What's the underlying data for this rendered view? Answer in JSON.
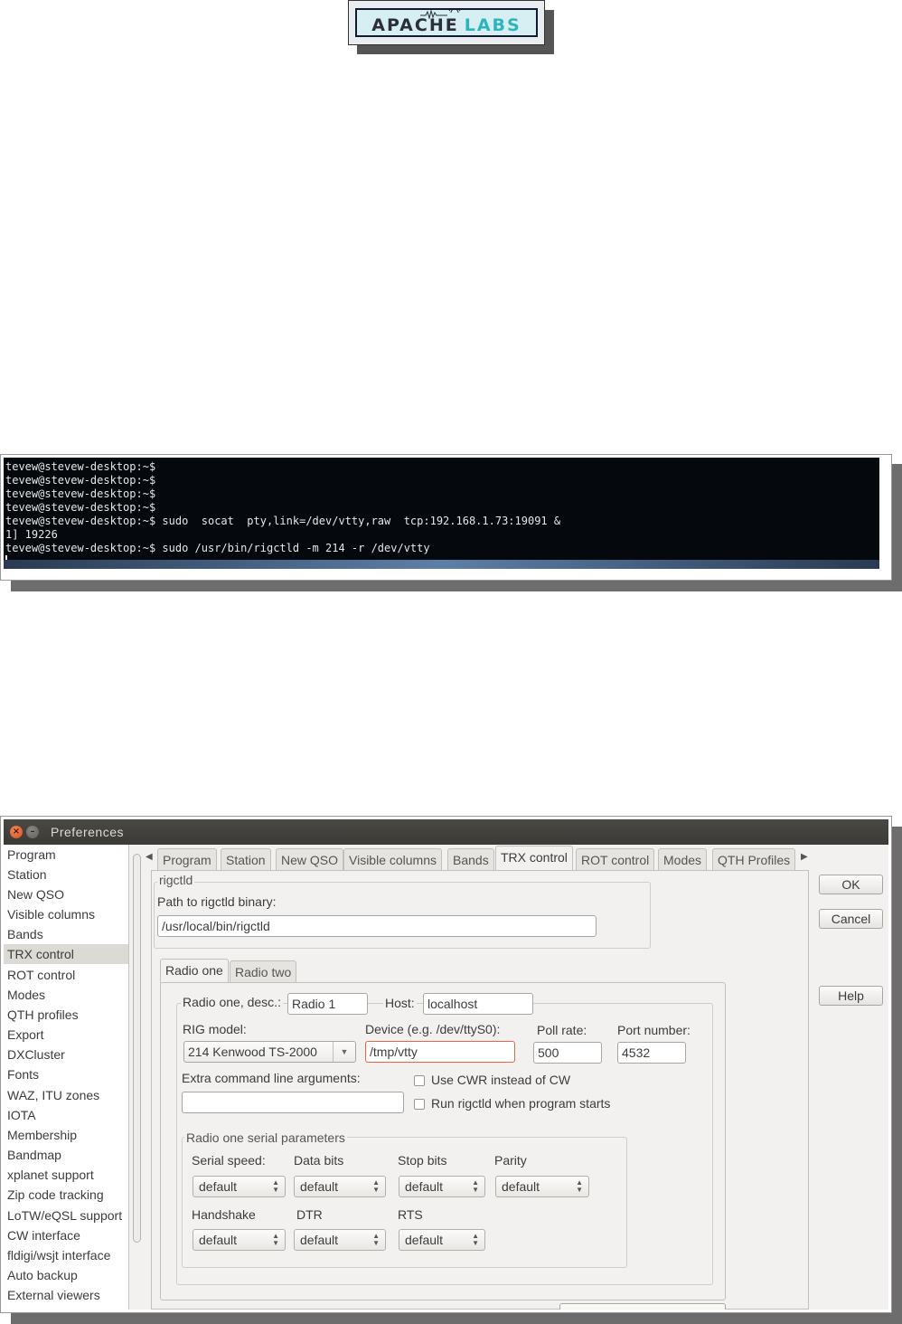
{
  "logo": {
    "part1": "APACHE",
    "part2": "LABS"
  },
  "terminal": {
    "lines": [
      "tevew@stevew-desktop:~$",
      "tevew@stevew-desktop:~$",
      "tevew@stevew-desktop:~$",
      "tevew@stevew-desktop:~$",
      "tevew@stevew-desktop:~$ sudo  socat  pty,link=/dev/vtty,raw  tcp:192.168.1.73:19091 &",
      "1] 19226",
      "tevew@stevew-desktop:~$ sudo /usr/bin/rigctld -m 214 -r /dev/vtty"
    ]
  },
  "window": {
    "title": "Preferences",
    "nav": [
      "Program",
      "Station",
      "New QSO",
      "Visible columns",
      "Bands",
      "TRX control",
      "ROT control",
      "Modes",
      "QTH profiles",
      "Export",
      "DXCluster",
      "Fonts",
      "WAZ, ITU zones",
      "IOTA",
      "Membership",
      "Bandmap",
      "xplanet support",
      "Zip code tracking",
      "LoTW/eQSL support",
      "CW interface",
      "fldigi/wsjt interface",
      "Auto backup",
      "External viewers"
    ],
    "nav_selected": "TRX control",
    "tabs": [
      "Program",
      "Station",
      "New QSO",
      "Visible columns",
      "Bands",
      "TRX control",
      "ROT control",
      "Modes",
      "QTH Profiles"
    ],
    "tab_selected": "TRX control",
    "rigctld": {
      "title": "rigctld",
      "path_label": "Path to rigctld binary:",
      "path_value": "/usr/local/bin/rigctld"
    },
    "subtabs": [
      "Radio one",
      "Radio two"
    ],
    "radio": {
      "desc_label": "Radio one, desc.:",
      "desc_value": "Radio 1",
      "host_label": "Host:",
      "host_value": "localhost",
      "rig_label": "RIG model:",
      "rig_value": "214 Kenwood TS-2000",
      "device_label": "Device (e.g. /dev/ttyS0):",
      "device_value": "/tmp/vtty",
      "poll_label": "Poll rate:",
      "poll_value": "500",
      "port_label": "Port number:",
      "port_value": "4532",
      "extra_label": "Extra command line arguments:",
      "extra_value": "",
      "cwr_label": "Use CWR instead of CW",
      "run_label": "Run rigctld when program starts"
    },
    "serial": {
      "title": "Radio one serial parameters",
      "speed_label": "Serial speed:",
      "databits_label": "Data bits",
      "stopbits_label": "Stop bits",
      "parity_label": "Parity",
      "handshake_label": "Handshake",
      "dtr_label": "DTR",
      "rts_label": "RTS",
      "default_value": "default"
    },
    "buttons": {
      "ok": "OK",
      "cancel": "Cancel",
      "help": "Help"
    }
  }
}
